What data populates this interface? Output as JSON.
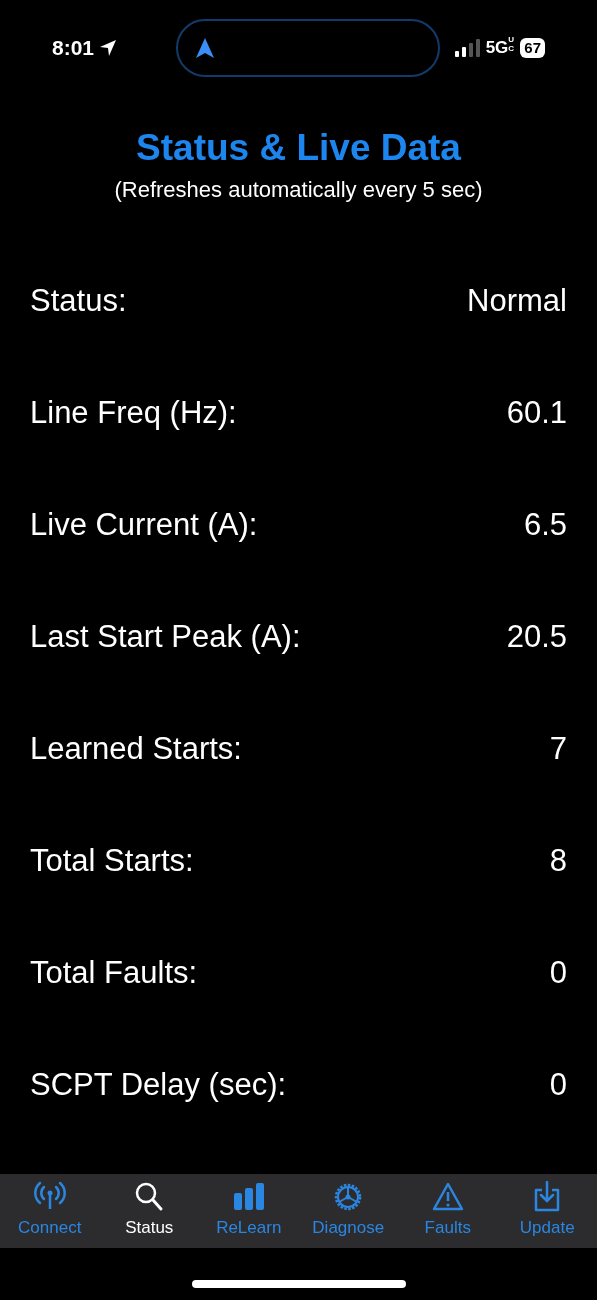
{
  "status_bar": {
    "time": "8:01",
    "network": "5G",
    "network_sub": "UC",
    "battery": "67"
  },
  "title": "Status & Live Data",
  "subtitle": "(Refreshes automatically every 5 sec)",
  "rows": [
    {
      "label": "Status:",
      "value": "Normal"
    },
    {
      "label": "Line Freq (Hz):",
      "value": "60.1"
    },
    {
      "label": "Live Current (A):",
      "value": "6.5"
    },
    {
      "label": "Last Start Peak (A):",
      "value": "20.5"
    },
    {
      "label": "Learned Starts:",
      "value": "7"
    },
    {
      "label": "Total Starts:",
      "value": "8"
    },
    {
      "label": "Total Faults:",
      "value": "0"
    },
    {
      "label": "SCPT Delay (sec):",
      "value": "0"
    }
  ],
  "tabs": [
    {
      "label": "Connect",
      "selected": false
    },
    {
      "label": "Status",
      "selected": true
    },
    {
      "label": "ReLearn",
      "selected": false
    },
    {
      "label": "Diagnose",
      "selected": false
    },
    {
      "label": "Faults",
      "selected": false
    },
    {
      "label": "Update",
      "selected": false
    }
  ]
}
